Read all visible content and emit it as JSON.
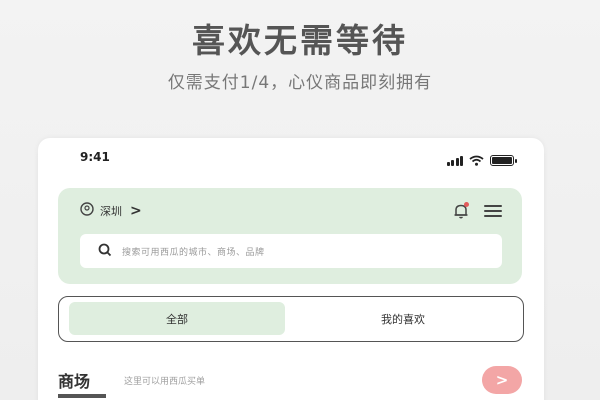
{
  "promo": {
    "headline": "喜欢无需等待",
    "subline": "仅需支付1/4，心仪商品即刻拥有"
  },
  "status_bar": {
    "time": "9:41",
    "battery_level": 1.0
  },
  "header": {
    "location_label": "深圳",
    "location_chevron": ">",
    "icons": [
      "location-pin-icon",
      "bell-icon",
      "menu-icon"
    ],
    "notification_dot_color": "#e25b5b"
  },
  "search": {
    "placeholder": "搜索可用西瓜的城市、商场、品牌"
  },
  "tabs": [
    {
      "label": "全部",
      "active": true
    },
    {
      "label": "我的喜欢",
      "active": false
    }
  ],
  "market_section": {
    "title": "商场",
    "description": "这里可以用西瓜买单",
    "arrow": ">"
  },
  "colors": {
    "accent_green": "#dfeedf",
    "accent_pink": "#f3a6a6",
    "text_dark": "#333333",
    "headline_gray": "#555555"
  }
}
